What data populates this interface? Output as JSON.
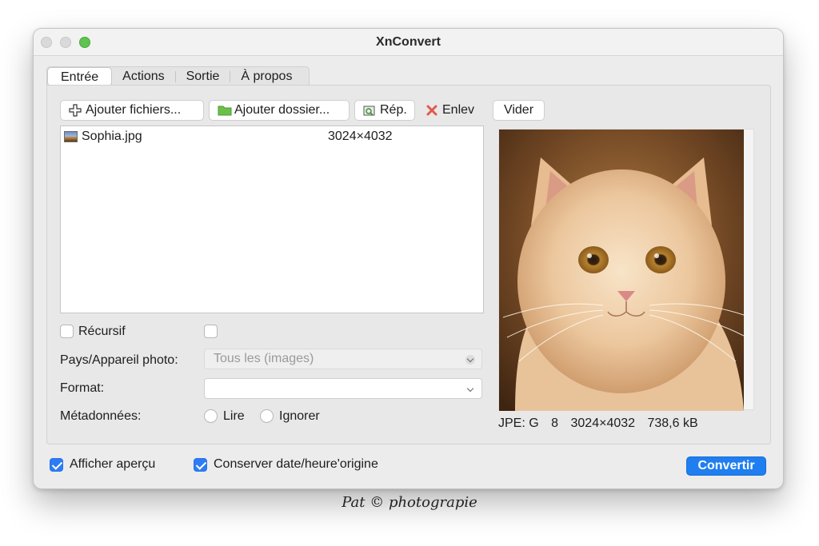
{
  "window": {
    "title": "XnConvert"
  },
  "tabs": [
    {
      "label": "Entrée",
      "active": true
    },
    {
      "label": "Actions",
      "active": false
    },
    {
      "label": "Sortie",
      "active": false
    },
    {
      "label": "À propos",
      "active": false
    }
  ],
  "toolbar": {
    "add_files": "Ajouter fichiers...",
    "add_folder": "Ajouter dossier...",
    "rep": "Rép.",
    "remove": "Enlev",
    "clear": "Vider"
  },
  "files": [
    {
      "name": "Sophia.jpg",
      "dimensions": "3024×4032"
    }
  ],
  "options": {
    "recursive_label": "Récursif",
    "recursive_checked": false,
    "extra_checkbox_checked": false,
    "country_label": "Pays/Appareil photo:",
    "country_value": "Tous les (images)",
    "format_label": "Format:",
    "format_value": "",
    "metadata_label": "Métadonnées:",
    "metadata_options": [
      "Lire",
      "Ignorer"
    ]
  },
  "preview": {
    "format": "JPE: G",
    "bits": "8",
    "dimensions": "3024×4032",
    "size": "738,6 kB"
  },
  "footer": {
    "show_preview_label": "Afficher aperçu",
    "show_preview_checked": true,
    "keep_date_label": "Conserver date/heure'origine",
    "keep_date_checked": true,
    "convert_label": "Convertir"
  },
  "credit": "Pat © photograpie",
  "colors": {
    "accent": "#1f7ef0",
    "zoom_button": "#5fc351"
  }
}
